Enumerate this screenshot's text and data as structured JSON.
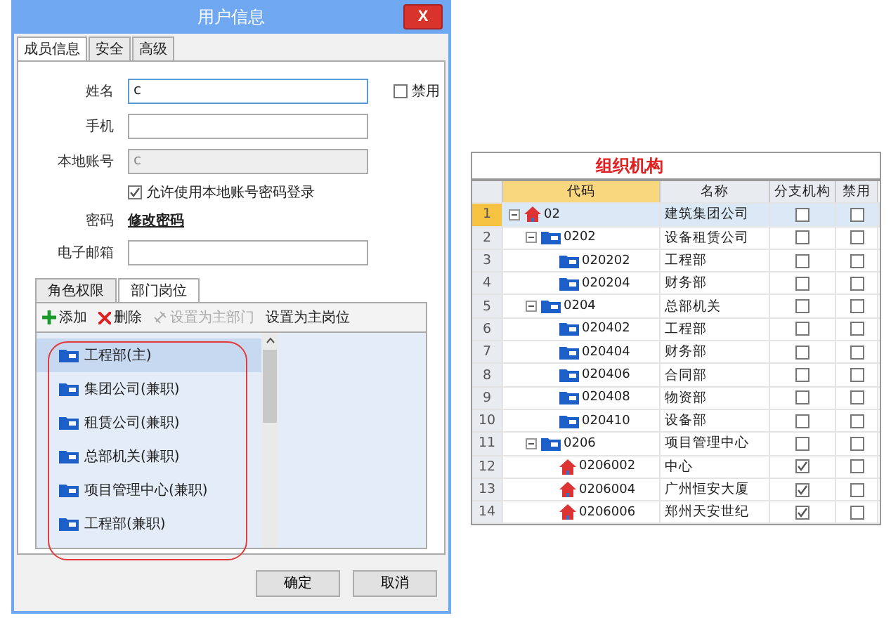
{
  "dialog": {
    "title": "用户信息",
    "close": "X",
    "tabs": [
      {
        "label": "成员信息",
        "selected": true
      },
      {
        "label": "安全",
        "selected": false
      },
      {
        "label": "高级",
        "selected": false
      }
    ],
    "form": [
      {
        "kind": "field",
        "label": "姓名",
        "value": "c",
        "focused": true,
        "disabled": false
      },
      {
        "kind": "field",
        "label": "手机",
        "focused": false,
        "disabled": false
      },
      {
        "kind": "field",
        "label": "本地账号",
        "value": "c",
        "focused": false,
        "disabled": true
      },
      {
        "kind": "check",
        "label": "允许使用本地账号密码登录",
        "checked": true
      },
      {
        "kind": "link",
        "label": "密码",
        "value": "修改密码"
      },
      {
        "kind": "field",
        "label": "电子邮箱",
        "focused": false,
        "disabled": false
      }
    ],
    "disable_check": {
      "label": "禁用",
      "checked": false
    },
    "inner_tabs": [
      {
        "label": "角色权限",
        "selected": false
      },
      {
        "label": "部门岗位",
        "selected": true
      }
    ],
    "toolbar": [
      {
        "kind": "add",
        "label": "添加",
        "disabled": false
      },
      {
        "kind": "delete",
        "label": "删除",
        "disabled": false
      },
      {
        "kind": "link",
        "label": "设置为主部门",
        "disabled": true
      },
      {
        "kind": "plain",
        "label": "设置为主岗位",
        "disabled": false
      }
    ],
    "positions": [
      {
        "label": "工程部(主)",
        "selected": true
      },
      {
        "label": "集团公司(兼职)",
        "selected": false
      },
      {
        "label": "租赁公司(兼职)",
        "selected": false
      },
      {
        "label": "总部机关(兼职)",
        "selected": false
      },
      {
        "label": "项目管理中心(兼职)",
        "selected": false
      },
      {
        "label": "工程部(兼职)",
        "selected": false
      }
    ],
    "buttons": [
      "确定",
      "取消"
    ]
  },
  "org": {
    "title": "组织机构",
    "columns": [
      {
        "label": "代码",
        "selected": true
      },
      {
        "label": "名称",
        "selected": false
      },
      {
        "label": "分支机构",
        "selected": false
      },
      {
        "label": "禁用",
        "selected": false
      }
    ],
    "rows": [
      {
        "num": "1",
        "code": "02",
        "name": "建筑集团公司",
        "expanded": true,
        "branch": false,
        "disabled": false,
        "selected": true,
        "children": [
          {
            "num": "2",
            "code": "0202",
            "name": "设备租赁公司",
            "expanded": true,
            "branch": false,
            "disabled": false,
            "selected": false,
            "children": [
              {
                "num": "3",
                "code": "020202",
                "name": "工程部",
                "branch": false,
                "disabled": false,
                "selected": false
              },
              {
                "num": "4",
                "code": "020204",
                "name": "财务部",
                "branch": false,
                "disabled": false,
                "selected": false
              }
            ]
          },
          {
            "num": "5",
            "code": "0204",
            "name": "总部机关",
            "expanded": true,
            "branch": false,
            "disabled": false,
            "selected": false,
            "children": [
              {
                "num": "6",
                "code": "020402",
                "name": "工程部",
                "branch": false,
                "disabled": false,
                "selected": false
              },
              {
                "num": "7",
                "code": "020404",
                "name": "财务部",
                "branch": false,
                "disabled": false,
                "selected": false
              },
              {
                "num": "8",
                "code": "020406",
                "name": "合同部",
                "branch": false,
                "disabled": false,
                "selected": false
              },
              {
                "num": "9",
                "code": "020408",
                "name": "物资部",
                "branch": false,
                "disabled": false,
                "selected": false
              },
              {
                "num": "10",
                "code": "020410",
                "name": "设备部",
                "branch": false,
                "disabled": false,
                "selected": false
              }
            ]
          },
          {
            "num": "11",
            "code": "0206",
            "name": "项目管理中心",
            "expanded": true,
            "branch": false,
            "disabled": false,
            "selected": false,
            "children": [
              {
                "num": "12",
                "code": "0206002",
                "name": "中心",
                "branch": true,
                "disabled": false,
                "selected": false
              },
              {
                "num": "13",
                "code": "0206004",
                "name": "广州恒安大厦",
                "branch": true,
                "disabled": false,
                "selected": false
              },
              {
                "num": "14",
                "code": "0206006",
                "name": "郑州天安世纪",
                "branch": true,
                "disabled": false,
                "selected": false
              }
            ]
          }
        ]
      }
    ]
  }
}
